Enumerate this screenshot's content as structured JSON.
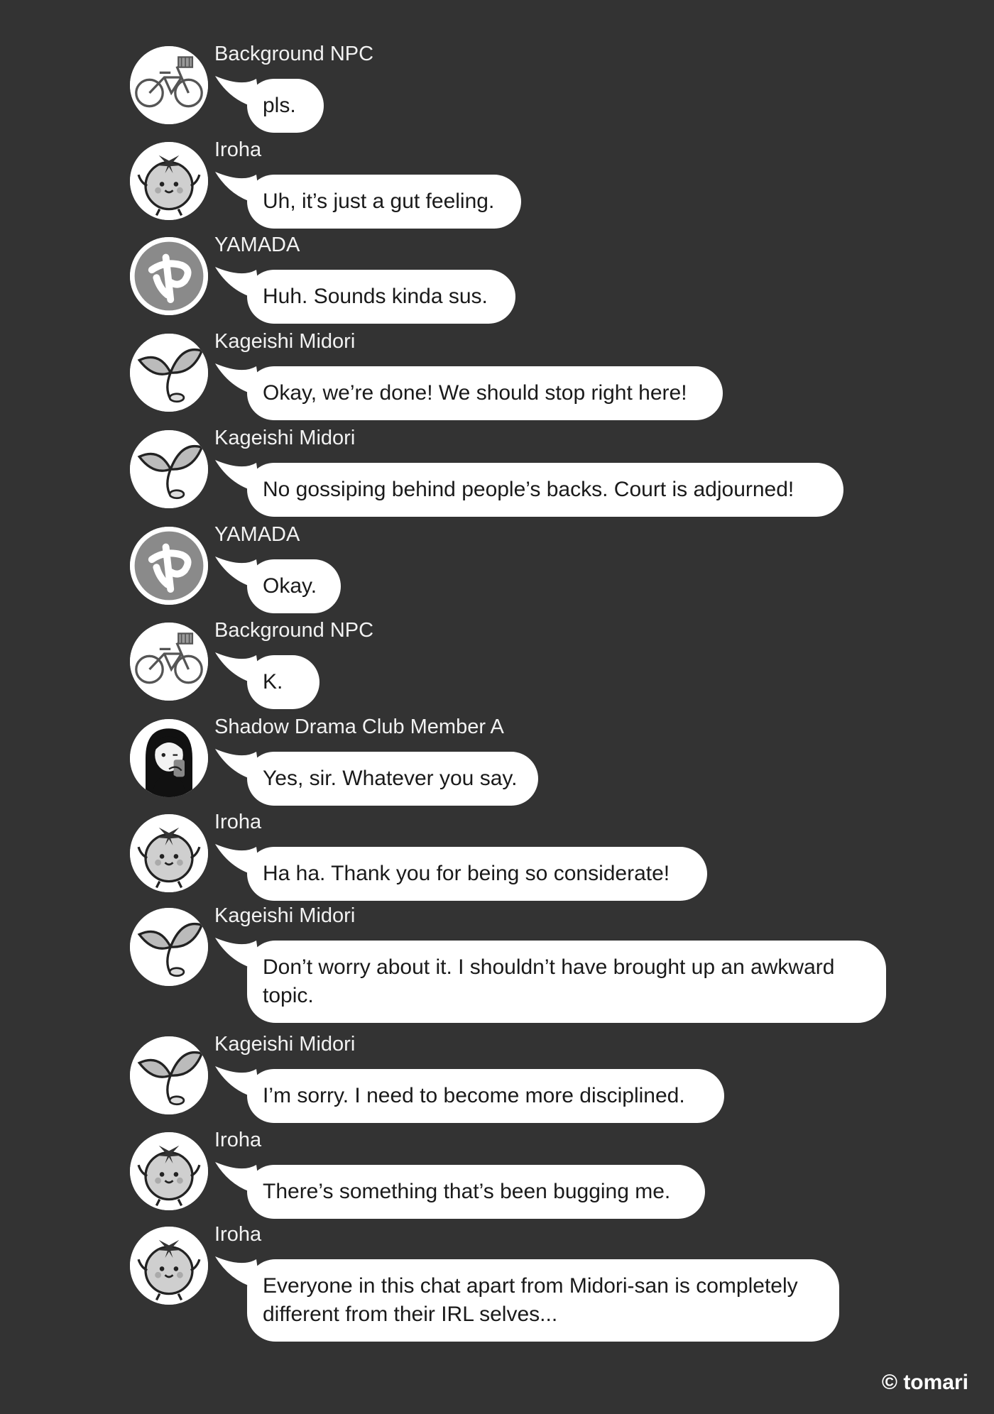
{
  "messages": [
    {
      "sender": "Background NPC",
      "avatar": "bicycle-icon",
      "text": "pls."
    },
    {
      "sender": "Iroha",
      "avatar": "tomato-icon",
      "text": "Uh, it’s just a gut feeling."
    },
    {
      "sender": "YAMADA",
      "avatar": "ya-icon",
      "text": "Huh. Sounds kinda sus."
    },
    {
      "sender": "Kageishi Midori",
      "avatar": "sprout-icon",
      "text": "Okay, we’re done! We should stop right here!"
    },
    {
      "sender": "Kageishi Midori",
      "avatar": "sprout-icon",
      "text": "No gossiping behind people’s backs. Court is adjourned!"
    },
    {
      "sender": "YAMADA",
      "avatar": "ya-icon",
      "text": "Okay."
    },
    {
      "sender": "Background NPC",
      "avatar": "bicycle-icon",
      "text": "K."
    },
    {
      "sender": "Shadow Drama Club Member A",
      "avatar": "girl-icon",
      "text": "Yes, sir. Whatever you say."
    },
    {
      "sender": "Iroha",
      "avatar": "tomato-icon",
      "text": "Ha ha. Thank you for being so considerate!"
    },
    {
      "sender": "Kageishi Midori",
      "avatar": "sprout-icon",
      "text": "Don’t worry about it. I shouldn’t have brought up an awkward topic."
    },
    {
      "sender": "Kageishi Midori",
      "avatar": "sprout-icon",
      "text": "I’m sorry. I need to become more disciplined."
    },
    {
      "sender": "Iroha",
      "avatar": "tomato-icon",
      "text": "There’s something that’s been bugging me."
    },
    {
      "sender": "Iroha",
      "avatar": "tomato-icon",
      "text": "Everyone in this chat apart from Midori-san is completely different from their IRL selves..."
    }
  ],
  "copyright": "© tomari"
}
